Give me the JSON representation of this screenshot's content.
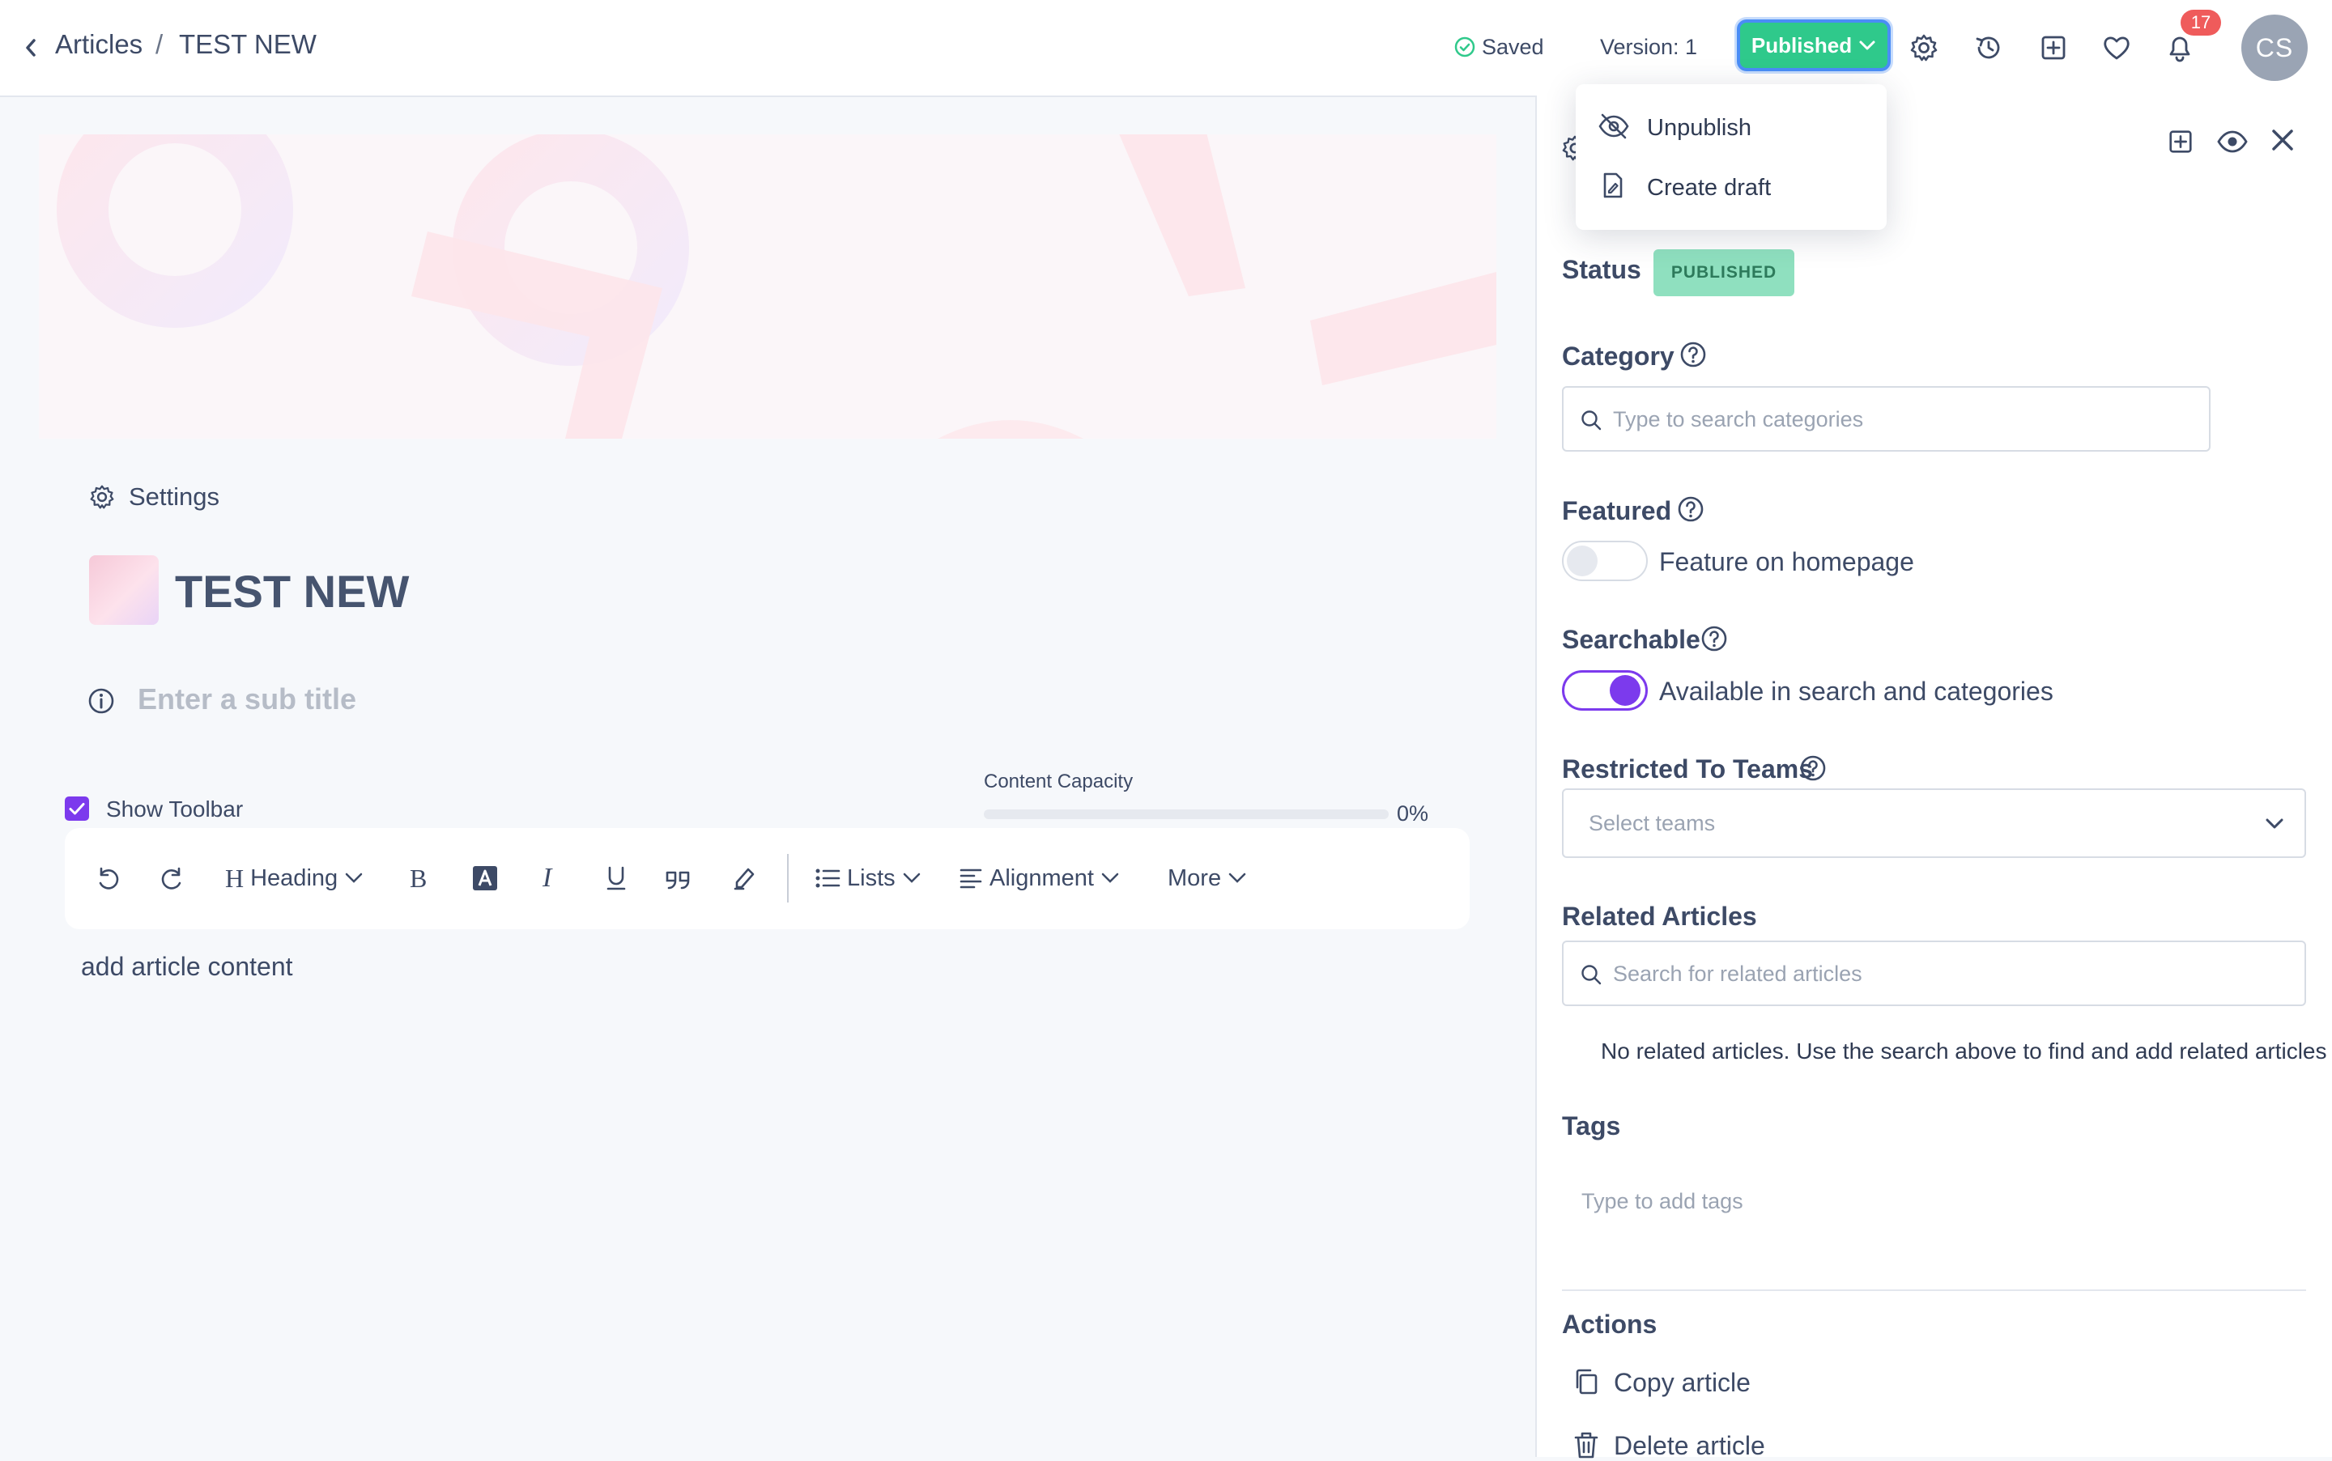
{
  "header": {
    "breadcrumb_root": "Articles",
    "breadcrumb_sep": "/",
    "breadcrumb_current": "TEST NEW",
    "saved_label": "Saved",
    "version_label": "Version: 1",
    "publish_button_label": "Published",
    "notification_count": "17",
    "avatar_initials": "CS"
  },
  "publish_menu": {
    "items": [
      {
        "label": "Unpublish",
        "icon": "eye-off-icon"
      },
      {
        "label": "Create draft",
        "icon": "file-draft-icon"
      }
    ]
  },
  "editor": {
    "settings_label": "Settings",
    "title": "TEST NEW",
    "subtitle_placeholder": "Enter a sub title",
    "show_toolbar_label": "Show Toolbar",
    "show_toolbar_checked": true,
    "content_capacity_label": "Content Capacity",
    "content_capacity_value": "0%",
    "content_capacity_fraction": 0,
    "content_placeholder": "add article content",
    "toolbar": {
      "heading_label": "Heading",
      "lists_label": "Lists",
      "alignment_label": "Alignment",
      "more_label": "More"
    }
  },
  "sidebar": {
    "status_label": "Status",
    "status_value": "PUBLISHED",
    "category_label": "Category",
    "category_placeholder": "Type to search categories",
    "featured_label": "Featured",
    "featured_toggle_label": "Feature on homepage",
    "featured_on": false,
    "searchable_label": "Searchable",
    "searchable_toggle_label": "Available in search and categories",
    "searchable_on": true,
    "restricted_label": "Restricted To Teams",
    "teams_placeholder": "Select teams",
    "related_label": "Related Articles",
    "related_placeholder": "Search for related articles",
    "related_empty": "No related articles. Use the search above to find and add related articles",
    "tags_label": "Tags",
    "tags_placeholder": "Type to add tags",
    "actions_label": "Actions",
    "copy_label": "Copy article",
    "delete_label": "Delete article"
  },
  "colors": {
    "accent": "#7c3aed",
    "published_green": "#2fc98b",
    "badge_red": "#ef5b5b",
    "text": "#3d4a66"
  }
}
